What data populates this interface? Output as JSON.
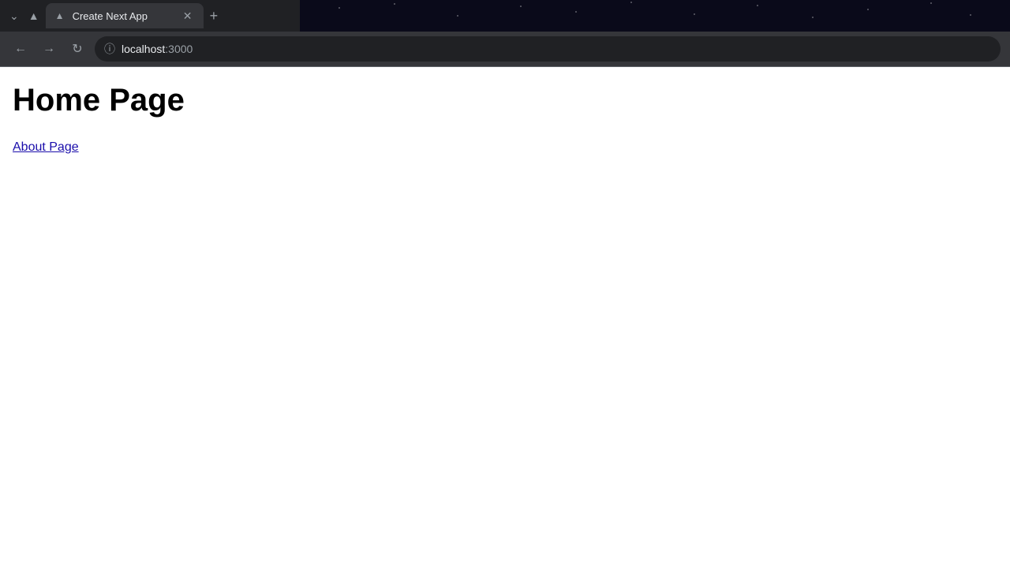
{
  "browser": {
    "tab": {
      "title": "Create Next App",
      "favicon": "▲"
    },
    "address": {
      "domain": "localhost",
      "port": ":3000",
      "full": "localhost:3000"
    },
    "nav": {
      "back": "←",
      "forward": "→",
      "reload": "↻"
    }
  },
  "page": {
    "heading": "Home Page",
    "link": "About Page"
  },
  "icons": {
    "chevron_down": "⌄",
    "upload": "▲",
    "close": "✕",
    "plus": "+",
    "info": "ⓘ"
  }
}
